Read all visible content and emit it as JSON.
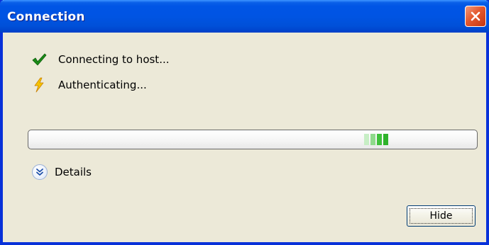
{
  "window": {
    "title": "Connection"
  },
  "titlebar": {
    "close_icon": "close-icon",
    "close_color": "#e4582e"
  },
  "status": [
    {
      "icon": "checkmark-icon",
      "text": "Connecting to host...",
      "color": "#1a8a17"
    },
    {
      "icon": "lightning-icon",
      "text": "Authenticating...",
      "color": "#f5c400"
    }
  ],
  "progress": {
    "mode": "indeterminate",
    "block_color": "#3fc13b"
  },
  "details": {
    "icon": "chevron-double-down-icon",
    "label": "Details"
  },
  "buttons": {
    "hide_label": "Hide"
  }
}
